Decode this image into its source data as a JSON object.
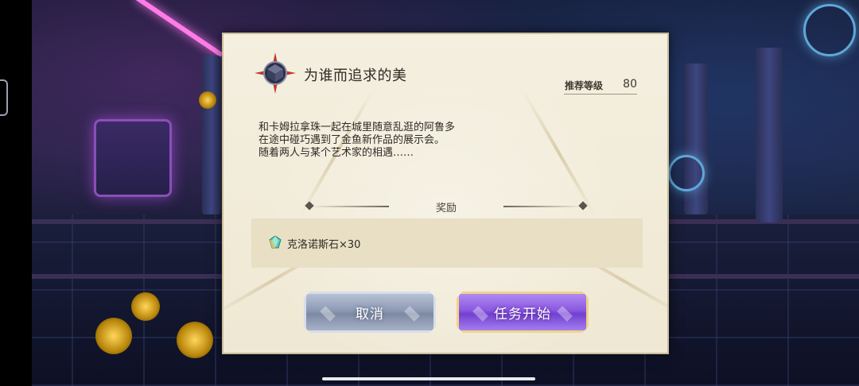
{
  "dialog": {
    "title": "为谁而追求的美",
    "recommended_level_label": "推荐等级",
    "recommended_level_value": "80",
    "description_lines": [
      "和卡姆拉拿珠一起在城里随意乱逛的阿鲁多",
      "在途中碰巧遇到了金鱼新作品的展示会。",
      "随着两人与某个艺术家的相遇……"
    ],
    "reward_heading": "奖励",
    "reward_item": "克洛诺斯石×30",
    "cancel_label": "取消",
    "start_label": "任务开始"
  },
  "icons": {
    "quest": "compass-star-icon",
    "reward": "kronos-stone-icon"
  },
  "colors": {
    "dialog_bg": "#f1ebd7",
    "start_button": "#8a58e0",
    "cancel_button": "#8e9ab4",
    "gold_border": "#f0d489"
  }
}
